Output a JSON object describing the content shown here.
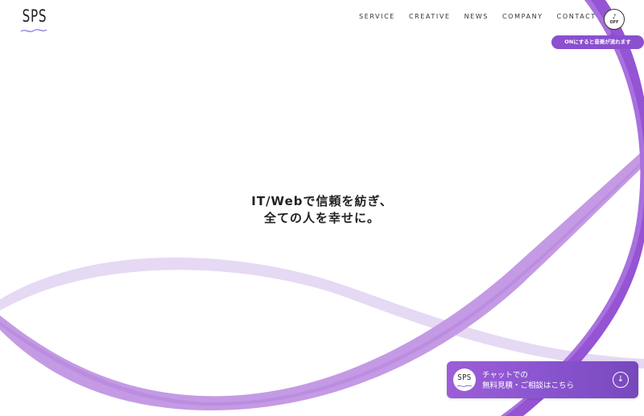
{
  "brand": {
    "logo_text": "SPS"
  },
  "nav": {
    "items": [
      {
        "label": "SERVICE"
      },
      {
        "label": "CREATIVE"
      },
      {
        "label": "NEWS"
      },
      {
        "label": "COMPANY"
      },
      {
        "label": "CONTACT"
      }
    ]
  },
  "sound": {
    "icon": "music-note-icon",
    "state_label": "OFF",
    "tooltip": "ONにすると音楽が流れます"
  },
  "hero": {
    "line1": "IT/Webで信頼を紡ぎ、",
    "line2": "全ての人を幸せに。"
  },
  "chat_cta": {
    "avatar_text": "SPS",
    "line1": "チャットでの",
    "line2": "無料見積・ご相談はこちら",
    "icon": "arrow-down-circle-icon"
  },
  "colors": {
    "accent": "#8b4fcf",
    "ribbon_light": "#e3d4f3",
    "ribbon_mid": "#c49be4",
    "ribbon_dark": "#9150d4",
    "background": "#ffffff"
  }
}
